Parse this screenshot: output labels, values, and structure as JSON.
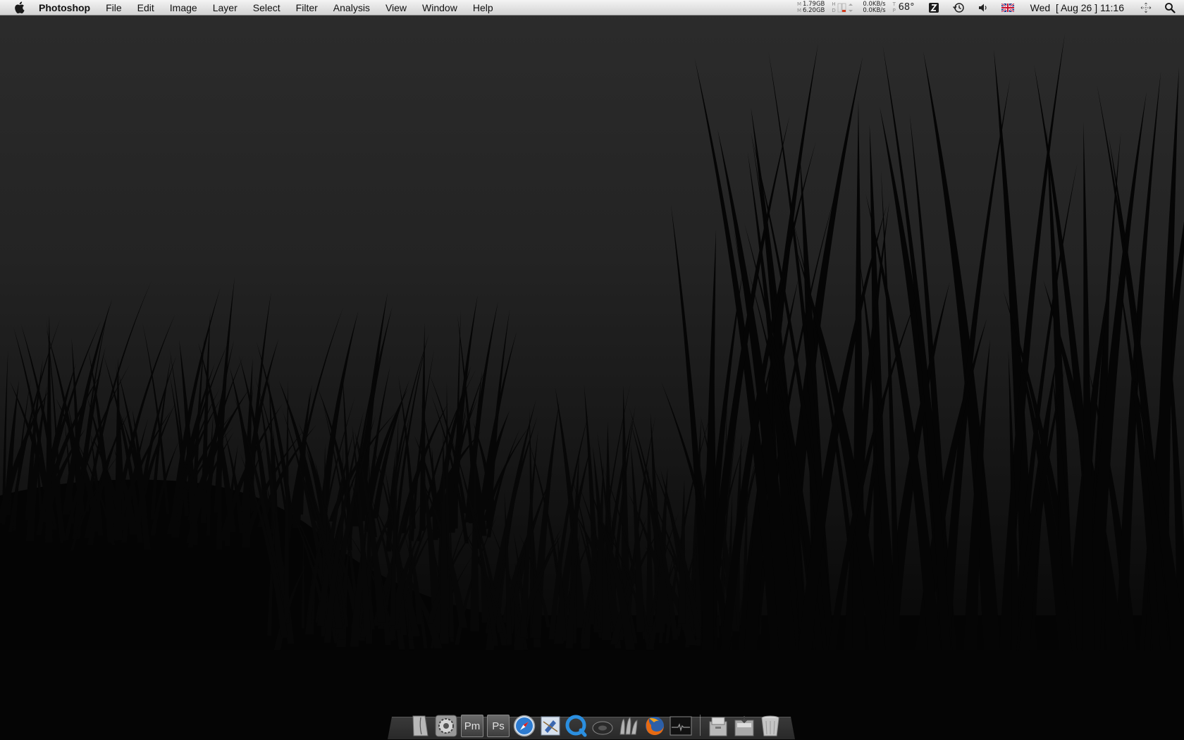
{
  "menubar": {
    "app_name": "Photoshop",
    "menus": [
      "File",
      "Edit",
      "Image",
      "Layer",
      "Select",
      "Filter",
      "Analysis",
      "View",
      "Window",
      "Help"
    ],
    "memory": {
      "label_top": "M",
      "label_bottom": "M",
      "used": "1.79GB",
      "free": "6.20GB"
    },
    "disk": {
      "label_top": "H",
      "label_bottom": "D"
    },
    "network": {
      "up": "0.0KB/s",
      "down": "0.0KB/s"
    },
    "temperature": {
      "label_top": "T",
      "label_bottom": "P",
      "value": "68°"
    },
    "datetime": "Wed  [ Aug 26 ] 11:16",
    "tray_icons": [
      "notify-icon",
      "time-machine-icon",
      "volume-icon",
      "uk-flag-icon",
      "spaces-icon",
      "spotlight-icon"
    ]
  },
  "dock": {
    "apps": [
      "finder-icon",
      "system-preferences-icon",
      "pm-app-icon",
      "photoshop-icon",
      "safari-icon",
      "mail-icon",
      "quicktime-icon",
      "itunes-icon",
      "adium-icon",
      "firefox-icon",
      "activity-monitor-icon"
    ],
    "pm_label": "Pm",
    "ps_label": "Ps",
    "stacks": [
      "applications-stack-icon",
      "downloads-stack-icon",
      "trash-icon"
    ]
  }
}
